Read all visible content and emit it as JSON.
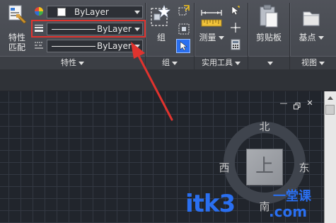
{
  "properties_panel": {
    "match_button_label_line1": "特性",
    "match_button_label_line2": "匹配",
    "color_dropdown_value": "ByLayer",
    "lineweight_dropdown_value": "ByLayer",
    "linetype_dropdown_value": "ByLayer",
    "title": "特性"
  },
  "groups_panel": {
    "group_button_label": "组",
    "title": "组"
  },
  "utilities_panel": {
    "measure_button_label": "测量",
    "title": "实用工具"
  },
  "clipboard_panel": {
    "clipboard_button_label": "剪贴板"
  },
  "view_panel": {
    "base_button_label": "基点",
    "title": "视图"
  },
  "viewcube": {
    "north": "北",
    "south": "南",
    "east": "东",
    "west": "西",
    "top_face": "上"
  },
  "window_controls": {
    "minimize": "—",
    "close": "✕"
  },
  "watermark": {
    "brand": "itk3",
    "tagline": "一堂课",
    "domain": ".com"
  },
  "colors": {
    "ribbon_bg": "#4a4d54",
    "canvas_bg": "#21252c",
    "highlight_red": "#e0332e",
    "watermark_blue": "#2a6ff0"
  }
}
